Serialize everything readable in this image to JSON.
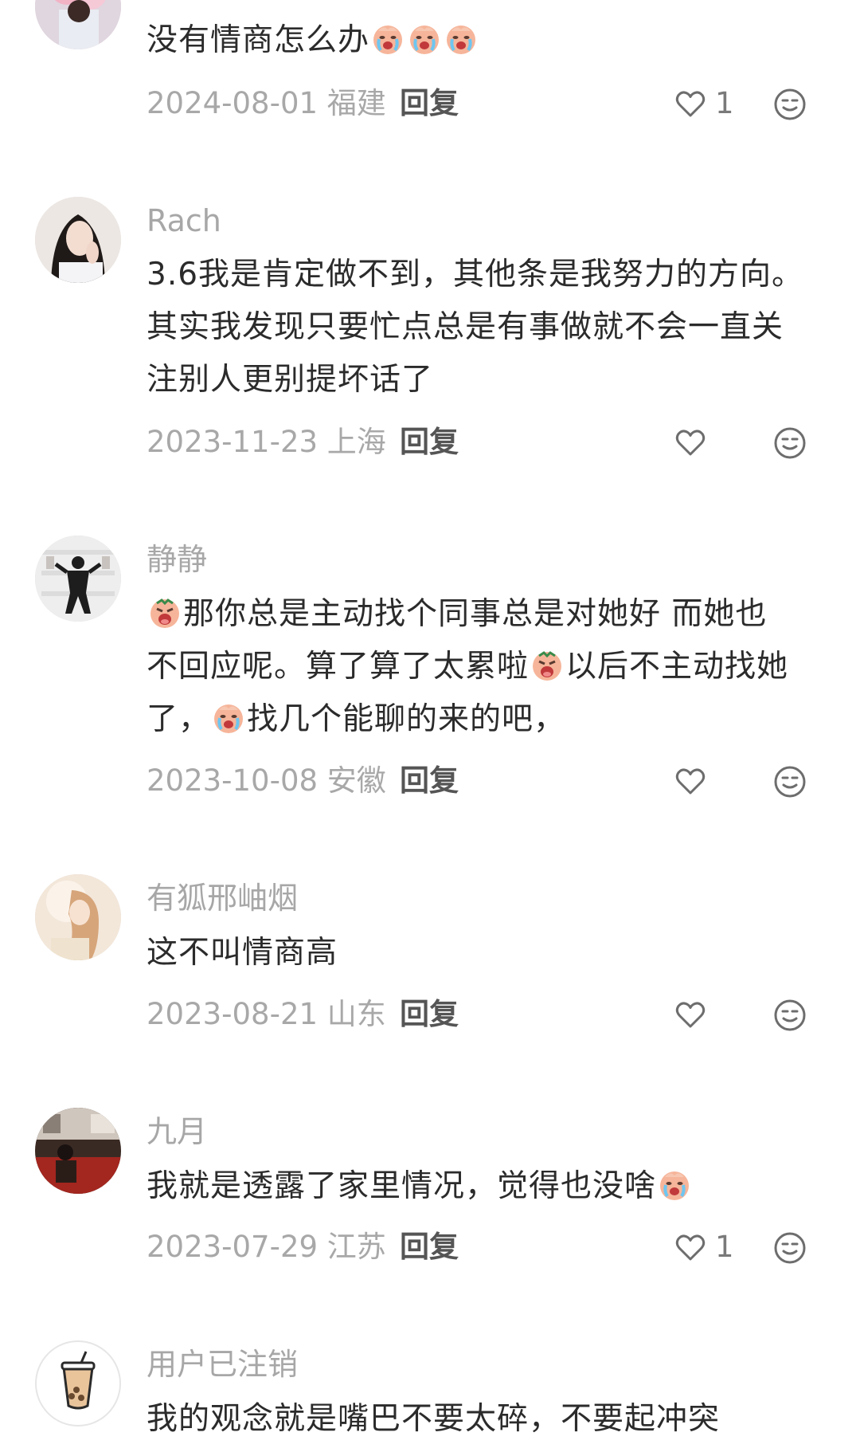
{
  "comments": [
    {
      "username": "",
      "avatar": "avatar-flowers",
      "lines": [
        [
          "没有情商怎么办",
          "cry-emoji",
          "cry-emoji",
          "cry-emoji"
        ]
      ],
      "date_location": "2024-08-01 福建",
      "reply_label": "回复",
      "likes": "1"
    },
    {
      "username": "Rach",
      "avatar": "avatar-girl",
      "lines": [
        [
          "3.6我是肯定做不到，其他条是我努力的方向。"
        ],
        [
          "其实我发现只要忙点总是有事做就不会一直关"
        ],
        [
          "注别人更别提坏话了"
        ]
      ],
      "date_location": "2023-11-23 上海",
      "reply_label": "回复",
      "likes": ""
    },
    {
      "username": "静静",
      "avatar": "avatar-dancer",
      "lines": [
        [
          "angry-emoji",
          "那你总是主动找个同事总是对她好 而她也"
        ],
        [
          "不回应呢。算了算了太累啦",
          "angry-emoji",
          "以后不主动找她"
        ],
        [
          "了，",
          "cry-emoji",
          "找几个能聊的来的吧，"
        ]
      ],
      "date_location": "2023-10-08 安徽",
      "reply_label": "回复",
      "likes": ""
    },
    {
      "username": "有狐邢岫烟",
      "avatar": "avatar-painting",
      "lines": [
        [
          "这不叫情商高"
        ]
      ],
      "date_location": "2023-08-21 山东",
      "reply_label": "回复",
      "likes": ""
    },
    {
      "username": "九月",
      "avatar": "avatar-room",
      "lines": [
        [
          "我就是透露了家里情况，觉得也没啥",
          "cry-emoji"
        ]
      ],
      "date_location": "2023-07-29 江苏",
      "reply_label": "回复",
      "likes": "1"
    },
    {
      "username": "用户已注销",
      "avatar": "avatar-bubble-tea",
      "lines": [
        [
          "我的观念就是嘴巴不要太碎，不要起冲突"
        ]
      ],
      "date_location": "",
      "reply_label": "",
      "likes": ""
    }
  ],
  "icons": {
    "like": "heart-outline-icon",
    "react": "smiley-icon"
  },
  "colors": {
    "username": "#a7a7a7",
    "text": "#2b2b2b",
    "meta": "#a8a8a8",
    "reply": "#555555"
  }
}
